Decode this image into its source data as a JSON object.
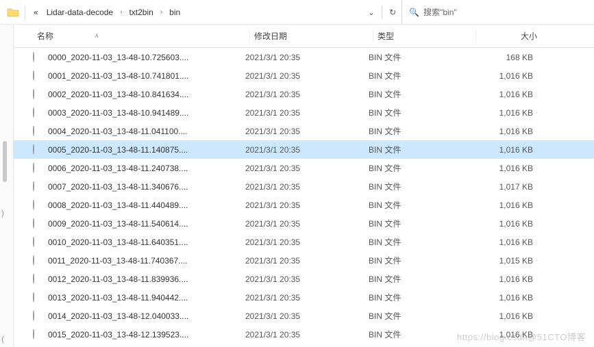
{
  "breadcrumb": {
    "overflow": "«",
    "parts": [
      "Lidar-data-decode",
      "txt2bin",
      "bin"
    ],
    "chevron": "›",
    "dropdown": "⌄",
    "refresh": "↻"
  },
  "search": {
    "icon": "🔍",
    "placeholder_text": "搜索\"bin\""
  },
  "columns": {
    "name": "名称",
    "date": "修改日期",
    "type": "类型",
    "size": "大小",
    "sort_indicator_up": "∧"
  },
  "files": [
    {
      "name": "0000_2020-11-03_13-48-10.725603....",
      "date": "2021/3/1 20:35",
      "type": "BIN 文件",
      "size": "168 KB",
      "selected": false
    },
    {
      "name": "0001_2020-11-03_13-48-10.741801....",
      "date": "2021/3/1 20:35",
      "type": "BIN 文件",
      "size": "1,016 KB",
      "selected": false
    },
    {
      "name": "0002_2020-11-03_13-48-10.841634....",
      "date": "2021/3/1 20:35",
      "type": "BIN 文件",
      "size": "1,016 KB",
      "selected": false
    },
    {
      "name": "0003_2020-11-03_13-48-10.941489....",
      "date": "2021/3/1 20:35",
      "type": "BIN 文件",
      "size": "1,016 KB",
      "selected": false
    },
    {
      "name": "0004_2020-11-03_13-48-11.041100....",
      "date": "2021/3/1 20:35",
      "type": "BIN 文件",
      "size": "1,016 KB",
      "selected": false
    },
    {
      "name": "0005_2020-11-03_13-48-11.140875....",
      "date": "2021/3/1 20:35",
      "type": "BIN 文件",
      "size": "1,016 KB",
      "selected": true
    },
    {
      "name": "0006_2020-11-03_13-48-11.240738....",
      "date": "2021/3/1 20:35",
      "type": "BIN 文件",
      "size": "1,016 KB",
      "selected": false
    },
    {
      "name": "0007_2020-11-03_13-48-11.340676....",
      "date": "2021/3/1 20:35",
      "type": "BIN 文件",
      "size": "1,017 KB",
      "selected": false
    },
    {
      "name": "0008_2020-11-03_13-48-11.440489....",
      "date": "2021/3/1 20:35",
      "type": "BIN 文件",
      "size": "1,016 KB",
      "selected": false
    },
    {
      "name": "0009_2020-11-03_13-48-11.540614....",
      "date": "2021/3/1 20:35",
      "type": "BIN 文件",
      "size": "1,016 KB",
      "selected": false
    },
    {
      "name": "0010_2020-11-03_13-48-11.640351....",
      "date": "2021/3/1 20:35",
      "type": "BIN 文件",
      "size": "1,016 KB",
      "selected": false
    },
    {
      "name": "0011_2020-11-03_13-48-11.740367....",
      "date": "2021/3/1 20:35",
      "type": "BIN 文件",
      "size": "1,015 KB",
      "selected": false
    },
    {
      "name": "0012_2020-11-03_13-48-11.839936....",
      "date": "2021/3/1 20:35",
      "type": "BIN 文件",
      "size": "1,016 KB",
      "selected": false
    },
    {
      "name": "0013_2020-11-03_13-48-11.940442....",
      "date": "2021/3/1 20:35",
      "type": "BIN 文件",
      "size": "1,016 KB",
      "selected": false
    },
    {
      "name": "0014_2020-11-03_13-48-12.040033....",
      "date": "2021/3/1 20:35",
      "type": "BIN 文件",
      "size": "1,016 KB",
      "selected": false
    },
    {
      "name": "0015_2020-11-03_13-48-12.139523....",
      "date": "2021/3/1 20:35",
      "type": "BIN 文件",
      "size": "1,016 KB",
      "selected": false
    }
  ],
  "watermark": "https://blog.csdn@51CTO博客",
  "nav_hints": {
    "p1": ")",
    "p2": "("
  }
}
